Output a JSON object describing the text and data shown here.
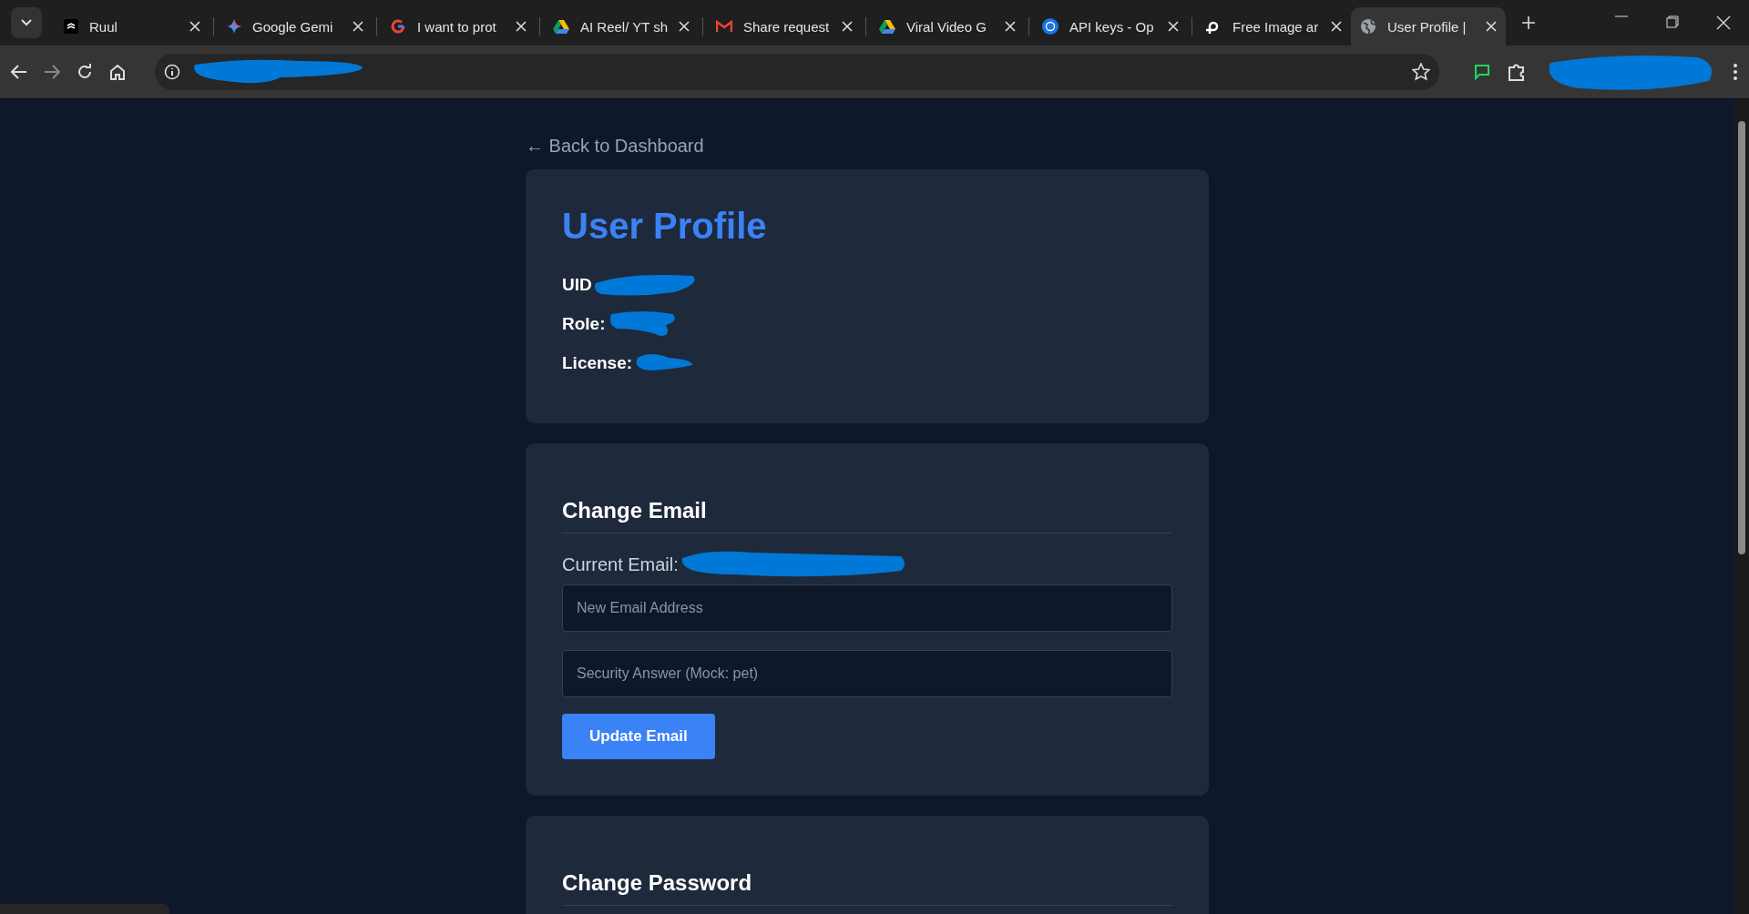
{
  "browser": {
    "tabs": [
      {
        "title": "Ruul",
        "selected": false
      },
      {
        "title": "Google Gemi",
        "selected": false
      },
      {
        "title": "I want to prot",
        "selected": false
      },
      {
        "title": "AI Reel/ YT sh",
        "selected": false
      },
      {
        "title": "Share request",
        "selected": false
      },
      {
        "title": "Viral Video G",
        "selected": false
      },
      {
        "title": "API keys - Op",
        "selected": false
      },
      {
        "title": "Free Image ar",
        "selected": false
      },
      {
        "title": "User Profile |",
        "selected": true
      }
    ]
  },
  "page": {
    "back_link": "← Back to Dashboard",
    "profile": {
      "title": "User Profile",
      "fields": [
        {
          "label": "UID"
        },
        {
          "label": "Role:"
        },
        {
          "label": "License:"
        }
      ]
    },
    "change_email": {
      "heading": "Change Email",
      "current_label": "Current Email:",
      "inputs": [
        {
          "placeholder": "New Email Address"
        },
        {
          "placeholder": "Security Answer (Mock: pet)"
        }
      ],
      "button": "Update Email"
    },
    "change_password": {
      "heading": "Change Password"
    }
  }
}
